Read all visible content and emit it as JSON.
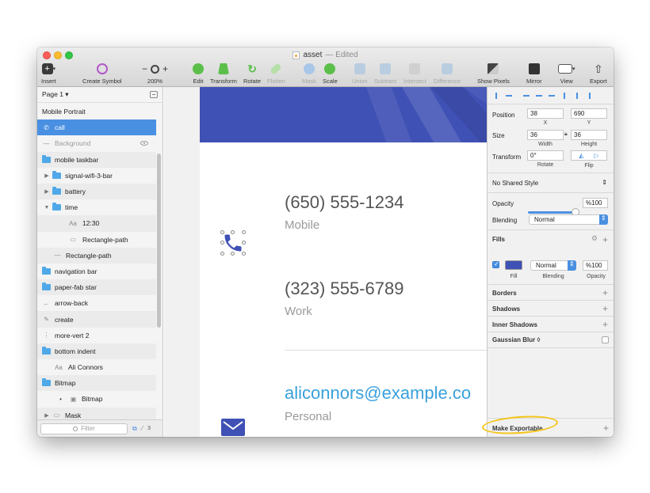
{
  "window": {
    "title": "asset",
    "edited": "— Edited"
  },
  "toolbar": {
    "items": [
      {
        "label": "Insert",
        "icon": "plus-icon"
      },
      {
        "label": "Create Symbol",
        "icon": "symbol-icon"
      },
      {
        "label": "200%",
        "icon": "zoom-icon"
      },
      {
        "label": "Edit",
        "icon": "edit-icon"
      },
      {
        "label": "Transform",
        "icon": "transform-icon"
      },
      {
        "label": "Rotate",
        "icon": "rotate-icon"
      },
      {
        "label": "Flatten",
        "icon": "flatten-icon"
      },
      {
        "label": "Mask",
        "icon": "mask-icon"
      },
      {
        "label": "Scale",
        "icon": "scale-icon"
      },
      {
        "label": "Union",
        "icon": "union-icon"
      },
      {
        "label": "Subtract",
        "icon": "subtract-icon"
      },
      {
        "label": "Intersect",
        "icon": "intersect-icon"
      },
      {
        "label": "Difference",
        "icon": "difference-icon"
      },
      {
        "label": "Show Pixels",
        "icon": "pixels-icon"
      },
      {
        "label": "Mirror",
        "icon": "mirror-icon"
      },
      {
        "label": "View",
        "icon": "view-icon"
      },
      {
        "label": "Export",
        "icon": "export-icon"
      }
    ],
    "zoom_minus": "−",
    "zoom_plus": "+"
  },
  "layers": {
    "page": "Page 1 ▾",
    "items": [
      {
        "label": "Mobile Portrait",
        "type": "artboard"
      },
      {
        "label": "call",
        "type": "shape",
        "icon": "phone-icon"
      },
      {
        "label": "Background",
        "type": "rect",
        "icon": "line-icon"
      },
      {
        "label": "mobile taskbar",
        "type": "folder"
      },
      {
        "label": "signal-wifi-3-bar",
        "type": "folder"
      },
      {
        "label": "battery",
        "type": "folder"
      },
      {
        "label": "time",
        "type": "folder"
      },
      {
        "label": "12:30",
        "type": "text",
        "icon": "text-icon"
      },
      {
        "label": "Rectangle-path",
        "type": "rect",
        "icon": "rect-icon"
      },
      {
        "label": "Rectangle-path",
        "type": "rect",
        "icon": "line-icon"
      },
      {
        "label": "navigation bar",
        "type": "folder"
      },
      {
        "label": "paper-fab star",
        "type": "folder"
      },
      {
        "label": "arrow-back",
        "type": "shape",
        "icon": "arrow-icon"
      },
      {
        "label": "create",
        "type": "shape",
        "icon": "pencil-icon"
      },
      {
        "label": "more-vert 2",
        "type": "shape",
        "icon": "dots-icon"
      },
      {
        "label": "bottom indent",
        "type": "folder"
      },
      {
        "label": "Ali Connors",
        "type": "text",
        "icon": "text-icon"
      },
      {
        "label": "Bitmap",
        "type": "folder"
      },
      {
        "label": "Bitmap",
        "type": "image",
        "icon": "image-icon"
      },
      {
        "label": "Mask",
        "type": "rect",
        "icon": "rect-icon"
      }
    ],
    "text_icon_glyph": "Aa",
    "filter_placeholder": "Filter",
    "footer_count": "3"
  },
  "canvas": {
    "contacts": [
      {
        "value": "(650) 555-1234",
        "type": "Mobile"
      },
      {
        "value": "(323) 555-6789",
        "type": "Work"
      }
    ],
    "email": {
      "value": "aliconnors@example.co",
      "type": "Personal"
    }
  },
  "inspector": {
    "position": {
      "label": "Position",
      "x": "38",
      "y": "690",
      "x_lbl": "X",
      "y_lbl": "Y"
    },
    "size": {
      "label": "Size",
      "w": "36",
      "h": "36",
      "w_lbl": "Width",
      "h_lbl": "Height"
    },
    "transform": {
      "label": "Transform",
      "rotate": "0°",
      "rotate_lbl": "Rotate",
      "flip_lbl": "Flip"
    },
    "shared_style": "No Shared Style",
    "opacity": {
      "label": "Opacity",
      "value": "%100",
      "level": 1.0
    },
    "blending": {
      "label": "Blending",
      "value": "Normal"
    },
    "fills": {
      "title": "Fills",
      "blend": "Normal",
      "opacity": "%100",
      "fill_lbl": "Fill",
      "blend_lbl": "Blending",
      "opacity_lbl": "Opacity",
      "color": "#3f51b5"
    },
    "sections": [
      "Borders",
      "Shadows",
      "Inner Shadows",
      "Gaussian Blur ◊"
    ],
    "export": "Make Exportable"
  },
  "colors": {
    "accent": "#4a90e2",
    "hero": "#3f51b5",
    "email": "#3aa0dc"
  }
}
